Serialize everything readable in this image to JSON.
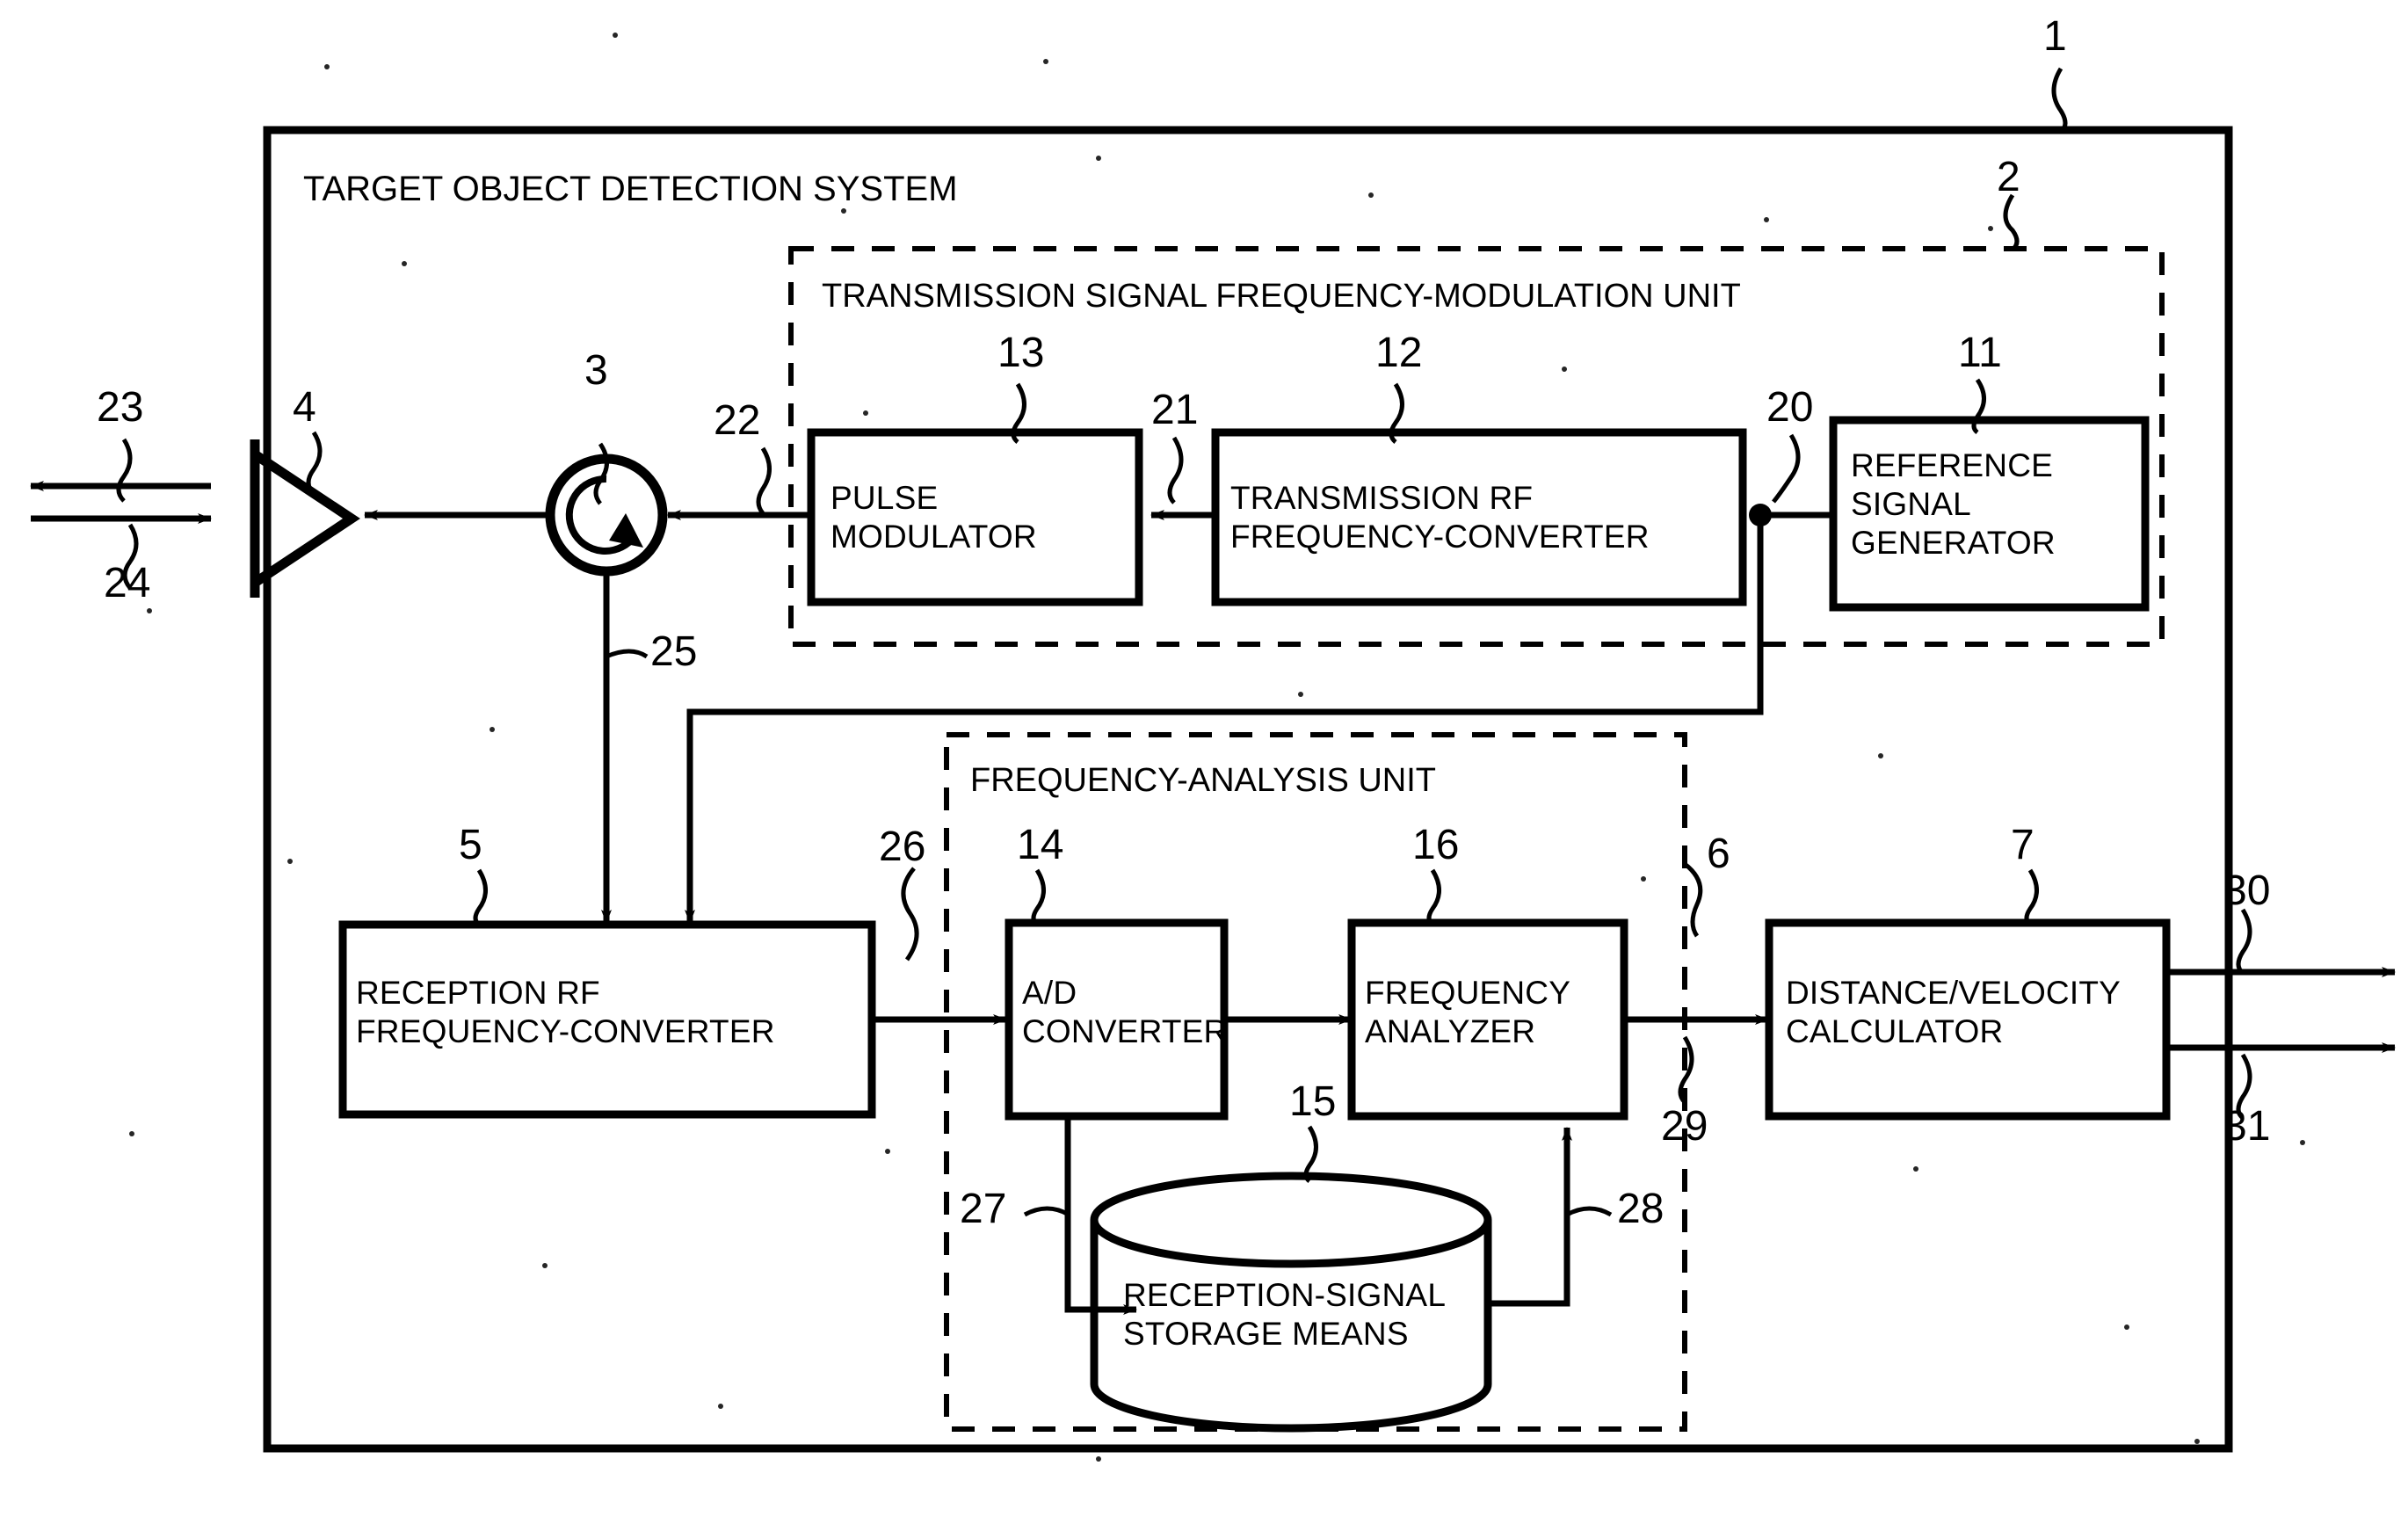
{
  "figure": {
    "system_title": "TARGET OBJECT DETECTION SYSTEM",
    "units": {
      "transmission": "TRANSMISSION SIGNAL FREQUENCY-MODULATION UNIT",
      "analysis": "FREQUENCY-ANALYSIS UNIT"
    },
    "blocks": {
      "pulse_modulator": "PULSE\nMODULATOR",
      "transmission_rf": "TRANSMISSION RF\nFREQUENCY-CONVERTER",
      "reference_generator": "REFERENCE\nSIGNAL\nGENERATOR",
      "reception_rf": "RECEPTION RF\nFREQUENCY-CONVERTER",
      "ad_converter": "A/D\nCONVERTER",
      "frequency_analyzer": "FREQUENCY\nANALYZER",
      "distance_velocity": "DISTANCE/VELOCITY\nCALCULATOR",
      "storage": "RECEPTION-SIGNAL\nSTORAGE MEANS"
    },
    "refs": {
      "r1": "1",
      "r2": "2",
      "r3": "3",
      "r4": "4",
      "r5": "5",
      "r6": "6",
      "r7": "7",
      "r11": "11",
      "r12": "12",
      "r13": "13",
      "r14": "14",
      "r15": "15",
      "r16": "16",
      "r20": "20",
      "r21": "21",
      "r22": "22",
      "r23": "23",
      "r24": "24",
      "r25": "25",
      "r26": "26",
      "r27": "27",
      "r28": "28",
      "r29": "29",
      "r30": "30",
      "r31": "31"
    },
    "colors": {
      "ink": "#000000",
      "paper": "#ffffff"
    }
  }
}
